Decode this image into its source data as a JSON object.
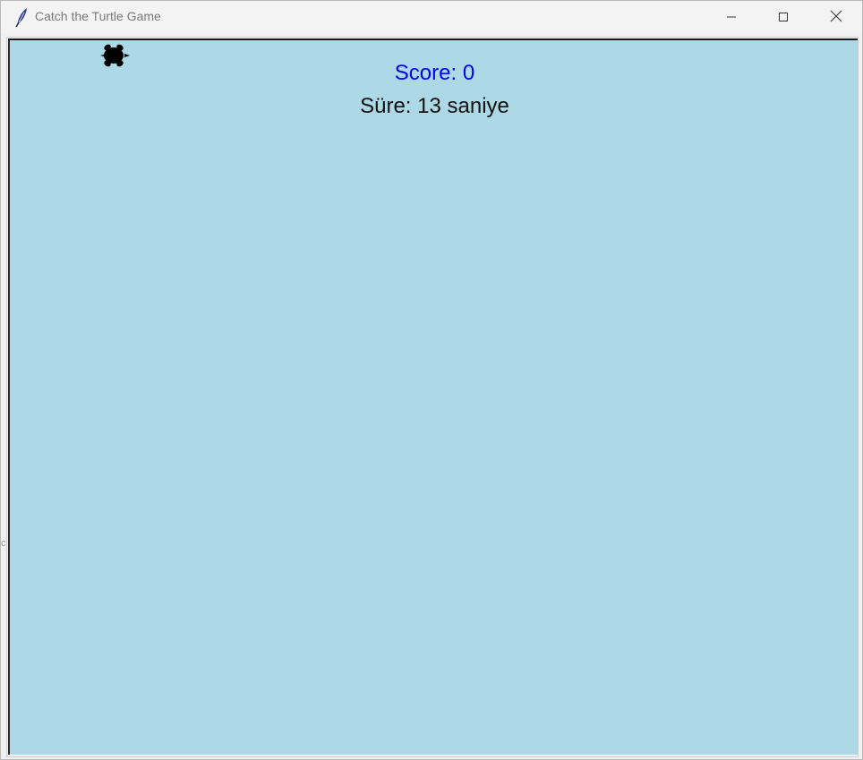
{
  "window": {
    "title": "Catch the Turtle Game",
    "app_icon": "feather-icon",
    "controls": {
      "minimize_icon": "minimize-icon",
      "maximize_icon": "maximize-icon",
      "close_icon": "close-icon"
    }
  },
  "game": {
    "background_color": "#add8e6",
    "score_text": "Score: 0",
    "score_color": "#0000ff",
    "timer_text": "Süre: 13 saniye",
    "timer_color": "#111111",
    "turtle": {
      "icon": "turtle-icon",
      "color": "#000000"
    }
  }
}
